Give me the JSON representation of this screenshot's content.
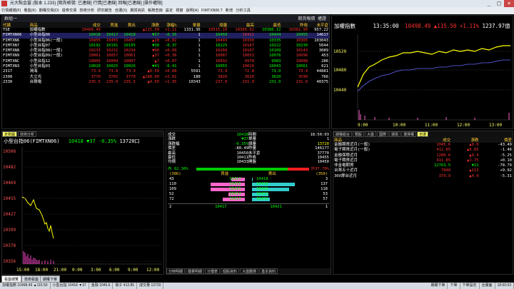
{
  "window": {
    "title": "元大點金靈 (版本 1.233) [期貨帳號: 已連線] 行情[已連線] 回報[已連線] [操作權限]",
    "controls": [
      "_",
      "□",
      "×"
    ]
  },
  "menu": [
    "行情報價(F)",
    "看盤(K)",
    "期權交易(D)",
    "證券交易",
    "技術分析",
    "研究報告",
    "自選(S)",
    "期貨資訊",
    "帳務查詢",
    "設定",
    "視窗",
    "說明(H)",
    "FIMTXN06.T",
    "新增",
    "分析工具"
  ],
  "quote_panel": {
    "title": "群組一",
    "header_right": "期貨報價 權證",
    "columns": [
      "代碼",
      "商品",
      "成交",
      "買進",
      "賣出",
      "漲跌",
      "漲幅%",
      "單量",
      "總量",
      "最高",
      "最低",
      "昨收",
      "未平倉"
    ],
    "rows": [
      {
        "code": "TSE",
        "name": "加權指數",
        "last": "10498.49",
        "bid": "",
        "ask": "",
        "chg": "▲115.50",
        "pct": "+1.11",
        "vol": "1331.36",
        "total": "10515.10",
        "high": "10369.02",
        "low": "10386.12",
        "prev": "10382.99",
        "oi": "957.22",
        "color": "rd"
      },
      {
        "code": "FIMTXN06",
        "name": "小型台指06",
        "last": "10418",
        "bid": "10417",
        "ask": "10418",
        "chg": "▼37",
        "pct": "-0.35",
        "vol": "1",
        "total": "10450",
        "high": "10411",
        "low": "10444",
        "prev": "10455",
        "oi": "14617",
        "color": "gr"
      },
      {
        "code": "FIMTXN6",
        "name": "小型台指06(一般)",
        "last": "10455",
        "bid": "10455",
        "ask": "10457",
        "chg": "▲10",
        "pct": "+0.02",
        "vol": "1",
        "total": "10493",
        "high": "10330",
        "low": "10335",
        "prev": "10365",
        "oi": "103043",
        "color": "rd"
      },
      {
        "code": "FIMTXN7",
        "name": "小型台指07",
        "last": "10192",
        "bid": "10191",
        "ask": "10195",
        "chg": "▼38",
        "pct": "-0.37",
        "vol": "1",
        "total": "10225",
        "high": "10187",
        "low": "10222",
        "prev": "10230",
        "oi": "5044",
        "color": "gr"
      },
      {
        "code": "FIMTXN8",
        "name": "小型台指08(一般)",
        "last": "10233",
        "bid": "10231",
        "ask": "10234",
        "chg": "▼90",
        "pct": "+0.09",
        "vol": "1",
        "total": "10266",
        "high": "10107",
        "low": "10109",
        "prev": "10143",
        "oi": "3089",
        "color": "rd"
      },
      {
        "code": "FIMTXN9",
        "name": "小型台指09(一般)",
        "last": "10061",
        "bid": "10057",
        "ask": "10061",
        "chg": "▲37",
        "pct": "+0.36",
        "vol": "1",
        "total": "10087",
        "high": "10053",
        "low": "10076",
        "prev": "10096",
        "oi": "453",
        "color": "rd"
      },
      {
        "code": "FIMTXNC",
        "name": "小型台指12",
        "last": "10005",
        "bid": "10004",
        "ask": "10007",
        "chg": "▲7",
        "pct": "+0.07",
        "vol": "1",
        "total": "10032",
        "high": "9978",
        "low": "9983",
        "prev": "10008",
        "oi": "286",
        "color": "rd"
      },
      {
        "code": "FIMTXN3",
        "name": "小型台指03",
        "last": "10020",
        "bid": "10025",
        "ask": "10026",
        "chg": "▼41",
        "pct": "-0.41",
        "vol": "1",
        "total": "10055",
        "high": "10020",
        "low": "10043",
        "prev": "10061",
        "oi": "621",
        "color": "gr"
      },
      {
        "code": "2317",
        "name": "鴻海",
        "last": "73.9",
        "bid": "73.8",
        "ask": "73.9",
        "chg": "▲0.50",
        "pct": "+0.68",
        "vol": "5591",
        "total": "73.9",
        "high": "72.8",
        "low": "73.0",
        "prev": "73.4",
        "oi": "44881",
        "color": "rd"
      },
      {
        "code": "2308",
        "name": "大立光",
        "last": "3770",
        "bid": "3765",
        "ask": "3770",
        "chg": "▲180.00",
        "pct": "+5.01",
        "vol": "180",
        "total": "3820",
        "high": "3620",
        "low": "3620",
        "prev": "3590",
        "oi": "766",
        "color": "rd"
      },
      {
        "code": "2330",
        "name": "台積電",
        "last": "235.5",
        "bid": "235.0",
        "ask": "235.5",
        "chg": "▲4.50",
        "pct": "+1.95",
        "vol": "10343",
        "total": "237.0",
        "high": "231.0",
        "low": "231.0",
        "prev": "231.0",
        "oi": "40375",
        "color": "rd"
      }
    ]
  },
  "index_chart": {
    "title": "加權指數",
    "time": "13:35:00",
    "price": "10498.49",
    "change": "▲115.50",
    "pct": "+1.11%",
    "amount": "1237.97億",
    "y_ticks": [
      "10520",
      "10480",
      "10440"
    ],
    "x_ticks": [
      "9:00",
      "10:00",
      "11:00",
      "12:00",
      "13:00"
    ]
  },
  "intraday": {
    "tabs": [
      "走勢圖",
      "技術分析"
    ],
    "name": "小型台指06(FIMTXN06)",
    "price": "10418",
    "change": "▼37 -0.35%",
    "volume": "13720口",
    "y_ticks": [
      "10508",
      "10482",
      "10469",
      "10455",
      "10427",
      "10399",
      "10378",
      "10356"
    ],
    "x_ticks": [
      "15:00",
      "18:00",
      "21:00",
      "0:00",
      "3:00",
      "6:00",
      "9:00",
      "12:00"
    ]
  },
  "detail": {
    "left": [
      {
        "k": "成交",
        "v": "10418",
        "c": "gr"
      },
      {
        "k": "漲跌",
        "v": "▼37",
        "c": "gr"
      },
      {
        "k": "漲跌幅",
        "v": "-0.35%",
        "c": "gr"
      },
      {
        "k": "價差",
        "v": "-80.49",
        "c": "wh"
      },
      {
        "k": "最高",
        "v": "10450",
        "c": "wh"
      },
      {
        "k": "最低",
        "v": "10411",
        "c": "wh"
      },
      {
        "k": "均價",
        "v": "10433",
        "c": "wh"
      }
    ],
    "right": [
      {
        "k": "時間",
        "v": "18:50:03",
        "c": "wh"
      },
      {
        "k": "單量",
        "v": "1",
        "c": "wh"
      },
      {
        "k": "總量",
        "v": "13720",
        "c": "yl"
      },
      {
        "k": "昨量",
        "v": "146177",
        "c": "wh"
      },
      {
        "k": "未平倉",
        "v": "37770",
        "c": "wh"
      },
      {
        "k": "昨收",
        "v": "10455",
        "c": "wh"
      },
      {
        "k": "開盤",
        "v": "10450",
        "c": "wh"
      }
    ],
    "inner_pct": "62.30%",
    "outer_pct": "37.70%",
    "inner_label": "內",
    "outer_label": "外",
    "bid_header": "買進",
    "ask_header": "賣出",
    "bid_total_label": "(386)",
    "ask_total_label": "(350)",
    "book": [
      {
        "bq": "43",
        "bp": "10417",
        "ap": "10418",
        "aq": "3"
      },
      {
        "bq": "110",
        "bp": "10416",
        "ap": "10419",
        "aq": "137"
      },
      {
        "bq": "109",
        "bp": "10415",
        "ap": "10420",
        "aq": "118"
      },
      {
        "bq": "52",
        "bp": "10414",
        "ap": "10421",
        "aq": "53"
      },
      {
        "bq": "72",
        "bp": "10413",
        "ap": "10422",
        "aq": "57"
      }
    ],
    "book_fill": [
      {
        "b": 0.31,
        "a": 0.02
      },
      {
        "b": 0.8,
        "a": 1.0
      },
      {
        "b": 0.8,
        "a": 0.86
      },
      {
        "b": 0.38,
        "a": 0.39
      },
      {
        "b": 0.52,
        "a": 0.42
      }
    ],
    "footer": {
      "left": "2",
      "bp": "10417",
      "ap": "10421",
      "right": "1"
    },
    "bottom_tabs": [
      "分時明細",
      "價量明細",
      "分價表",
      "個股資料",
      "大盤動態",
      "基本資料"
    ]
  },
  "sector": {
    "tabs": [
      "期權組合",
      "類股",
      "大盤",
      "國際",
      "期貨",
      "選擇權",
      "自選"
    ],
    "columns": [
      "商品",
      "成交",
      "漲跌",
      "價差"
    ],
    "rows": [
      {
        "name": "金融期貨近月(一般)",
        "last": "1045.6",
        "chg": "▲9.0",
        "spread": "-43.49",
        "c": "rd"
      },
      {
        "name": "電子期貨近月(一般)",
        "last": "412.85",
        "chg": "▲0.85",
        "spread": "-1.46",
        "c": "rd"
      },
      {
        "name": "金融保險近月",
        "last": "1280.6",
        "chg": "▲9.4",
        "spread": "-5.25",
        "c": "rd"
      },
      {
        "name": "電子期貨近月",
        "last": "411.85",
        "chg": "▲1.75",
        "spread": "+0.10",
        "c": "rd"
      },
      {
        "name": "非金電期貨",
        "last": "12763.5",
        "chg": "▼21",
        "spread": "-78.79",
        "c": "gr"
      },
      {
        "name": "台灣五十近月",
        "last": "7848",
        "chg": "▲113",
        "spread": "+9.92",
        "c": "rd"
      },
      {
        "name": "30X摩台近月",
        "last": "379.9",
        "chg": "▲4.9",
        "spread": "-5.31",
        "c": "rd"
      }
    ]
  },
  "bottom_tabs": [
    "看盤總覽",
    "技術看盤",
    "期權下單"
  ],
  "status": [
    "加權指數 10498.49 ▲115.50",
    "小型台指 10418 ▼37",
    "金融 1045.6",
    "電子 412.85",
    "成交量 13720"
  ],
  "status_right": [
    "期權下單",
    "下單",
    "下單設定",
    "全畫面",
    "18:50:03"
  ],
  "colors": {
    "up": "#ff3030",
    "down": "#00ff00",
    "accent": "#ffff00",
    "background": "#000000"
  }
}
